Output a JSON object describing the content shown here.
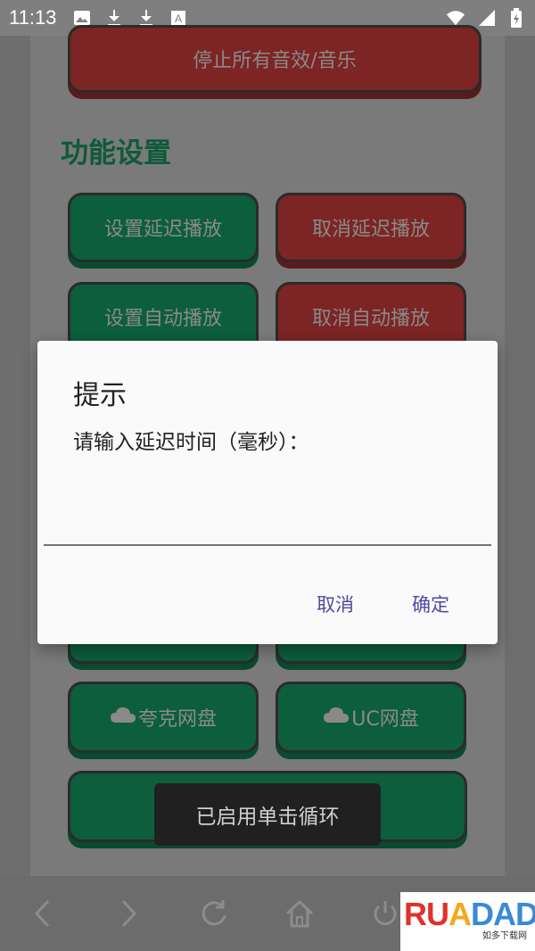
{
  "status_bar": {
    "time": "11:13"
  },
  "top_button": {
    "label": "停止所有音效/音乐"
  },
  "section": {
    "title": "功能设置"
  },
  "buttons": {
    "set_delay": "设置延迟播放",
    "cancel_delay": "取消延迟播放",
    "set_auto": "设置自动播放",
    "cancel_auto": "取消自动播放",
    "quark": "夸克网盘",
    "uc": "UC网盘"
  },
  "dialog": {
    "title": "提示",
    "message": "请输入延迟时间（毫秒）：",
    "input_value": "",
    "cancel_label": "取消",
    "confirm_label": "确定"
  },
  "toast": {
    "text": "已启用单击循环"
  },
  "watermark": {
    "logo": "RUADAD",
    "sub": "如多下载网"
  },
  "colors": {
    "green_button": "#0c5e3d",
    "red_button": "#7d2424",
    "dialog_accent": "#4c4aa0"
  }
}
